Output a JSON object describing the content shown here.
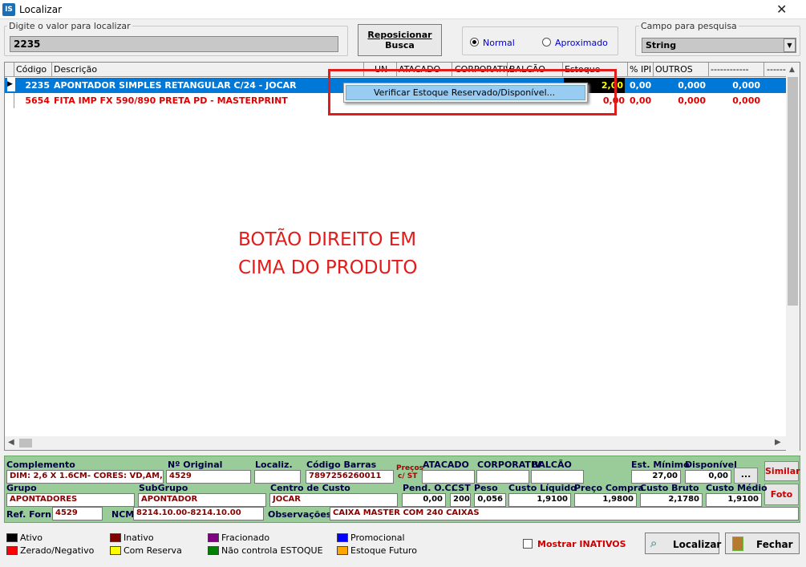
{
  "window": {
    "title": "Localizar",
    "close": "✕",
    "app_icon": "IS"
  },
  "search": {
    "group_label": "Digite o valor para localizar",
    "value": "2235"
  },
  "reposition": {
    "line1": "Reposicionar",
    "line2": "Busca"
  },
  "mode": {
    "normal": "Normal",
    "approx": "Aproximado",
    "selected": "normal"
  },
  "campo": {
    "group_label": "Campo para pesquisa",
    "value": "String",
    "arrow": "▼"
  },
  "grid": {
    "headers": [
      "Código",
      "Descrição",
      "UN",
      "ATACADO",
      "CORPORATIV",
      "BALCÃO",
      "Estoque",
      "% IPI",
      "OUTROS",
      "------------",
      "------------"
    ],
    "rows": [
      {
        "codigo": "2235",
        "descricao": "APONTADOR SIMPLES RETANGULAR  C/24 - JOCAR",
        "estoque": "2,00",
        "ipi": "0,00",
        "outros": "0,000",
        "extra": "0,000",
        "color": "#ffffff",
        "bg": "#0078d7"
      },
      {
        "codigo": "5654",
        "descricao": "FITA IMP FX 590/890 PRETA PD - MASTERPRINT",
        "estoque": "0,00",
        "ipi": "0,00",
        "outros": "0,000",
        "extra": "0,000",
        "color": "#e00000",
        "bg": "#ffffff"
      }
    ]
  },
  "context_menu": {
    "item": "Verificar Estoque Reservado/Disponível..."
  },
  "annotation": {
    "line1": "BOTÃO DIREITO EM",
    "line2": "CIMA DO PRODUTO"
  },
  "details": {
    "complemento_label": "Complemento",
    "complemento": "DIM: 2,6 X 1.6CM- CORES: VD,AM,AZ,",
    "original_label": "Nº Original",
    "original": "4529",
    "localiz_label": "Localiz.",
    "localiz": "",
    "barras_label": "Código Barras",
    "barras": "7897256260011",
    "precos_label1": "Preços",
    "precos_label2": "c/ ST",
    "atacado_label": "ATACADO",
    "corporativ_label": "CORPORATIV",
    "balcao_label": "BALCÃO",
    "estmin_label": "Est. Mínimo",
    "estmin": "27,00",
    "disponivel_label": "Disponível",
    "disponivel": "0,00",
    "dots": "...",
    "grupo_label": "Grupo",
    "grupo": "APONTADORES",
    "subgrupo_label": "SubGrupo",
    "subgrupo": "APONTADOR",
    "centro_label": "Centro de Custo",
    "centro": "JOCAR",
    "pendoc_label": "Pend. O.C.",
    "pendoc": "0,00",
    "cst_label": "CST",
    "cst": "200",
    "peso_label": "Peso",
    "peso": "0,056",
    "custoliq_label": "Custo Líquido",
    "custoliq": "1,9100",
    "precocompra_label": "Preço Compra",
    "precocompra": "1,9800",
    "custobruto_label": "Custo Bruto",
    "custobruto": "2,1780",
    "customedio_label": "Custo Médio",
    "customedio": "1,9100",
    "reffor_label": "Ref. Forn",
    "reffor": "4529",
    "ncm_label": "NCM",
    "ncm": "8214.10.00-8214.10.00",
    "obs_label": "Observações",
    "obs": "CAIXA MASTER COM 240 CAIXAS",
    "similar": "Similar",
    "foto": "Foto"
  },
  "legend": [
    {
      "label": "Ativo",
      "color": "#000000"
    },
    {
      "label": "Inativo",
      "color": "#800000"
    },
    {
      "label": "Fracionado",
      "color": "#800080"
    },
    {
      "label": "Promocional",
      "color": "#0000ff"
    },
    {
      "label": "Zerado/Negativo",
      "color": "#ff0000"
    },
    {
      "label": "Com Reserva",
      "color": "#ffff00"
    },
    {
      "label": "Não controla ESTOQUE",
      "color": "#008000"
    },
    {
      "label": "Estoque Futuro",
      "color": "#ffa500"
    }
  ],
  "footer": {
    "mostrar": "Mostrar INATIVOS",
    "localizar": "Localizar",
    "fechar": "Fechar"
  }
}
